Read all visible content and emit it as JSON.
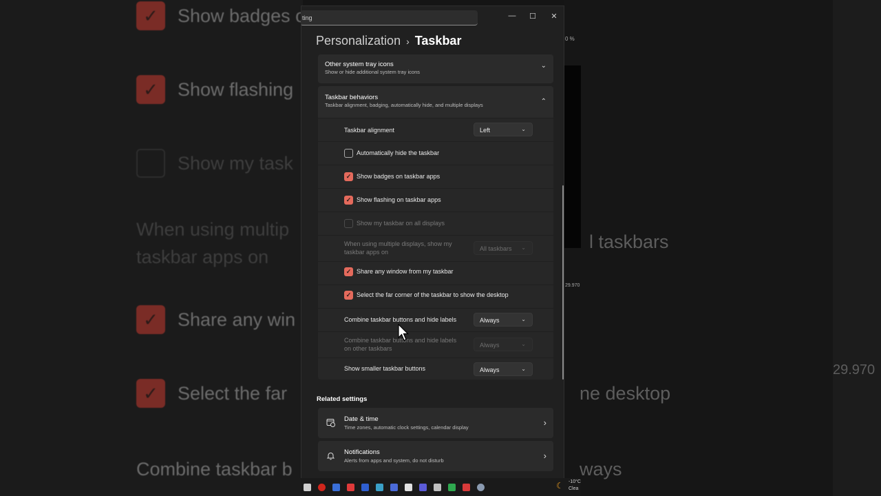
{
  "window": {
    "search_text": "ting",
    "minimize": "—",
    "maximize": "☐",
    "close": "✕"
  },
  "breadcrumb": {
    "parent": "Personalization",
    "separator": "›",
    "current": "Taskbar"
  },
  "cards": {
    "tray": {
      "title": "Other system tray icons",
      "subtitle": "Show or hide additional system tray icons",
      "chevron": "⌄"
    },
    "behaviors": {
      "title": "Taskbar behaviors",
      "subtitle": "Taskbar alignment, badging, automatically hide, and multiple displays",
      "chevron": "⌃"
    }
  },
  "behaviors": {
    "alignment": {
      "label": "Taskbar alignment",
      "value": "Left"
    },
    "auto_hide": {
      "label": "Automatically hide the taskbar",
      "checked": false
    },
    "badges": {
      "label": "Show badges on taskbar apps",
      "checked": true
    },
    "flashing": {
      "label": "Show flashing on taskbar apps",
      "checked": true
    },
    "all_displays": {
      "label": "Show my taskbar on all displays",
      "checked": false,
      "disabled": true
    },
    "multi_display": {
      "label": "When using multiple displays, show my taskbar apps on",
      "value": "All taskbars",
      "disabled": true
    },
    "share_window": {
      "label": "Share any window from my taskbar",
      "checked": true
    },
    "far_corner": {
      "label": "Select the far corner of the taskbar to show the desktop",
      "checked": true
    },
    "combine": {
      "label": "Combine taskbar buttons and hide labels",
      "value": "Always"
    },
    "combine_other": {
      "label": "Combine taskbar buttons and hide labels on other taskbars",
      "value": "Always",
      "disabled": true
    },
    "smaller": {
      "label": "Show smaller taskbar buttons",
      "value": "Always"
    },
    "check_glyph": "✓",
    "dd_chevron": "⌄"
  },
  "related": {
    "heading": "Related settings",
    "items": [
      {
        "title": "Date & time",
        "subtitle": "Time zones, automatic clock settings, calendar display",
        "icon": "clock-calendar-icon",
        "chevron": "›"
      },
      {
        "title": "Notifications",
        "subtitle": "Alerts from apps and system, do not disturb",
        "icon": "bell-icon",
        "chevron": "›"
      }
    ]
  },
  "tray": {
    "temp": "-10°C",
    "desc": "Clea"
  },
  "background": {
    "left": [
      "Show badges o",
      "Show flashing",
      "Show my task",
      "When using multip",
      "taskbar apps on",
      "Share any win",
      "Select the far",
      "Combine taskbar b"
    ],
    "right": [
      "l taskbars",
      "ne desktop",
      "ways",
      "29.970",
      "0 %",
      "29.970"
    ]
  },
  "accent_color": "#e46a5c"
}
